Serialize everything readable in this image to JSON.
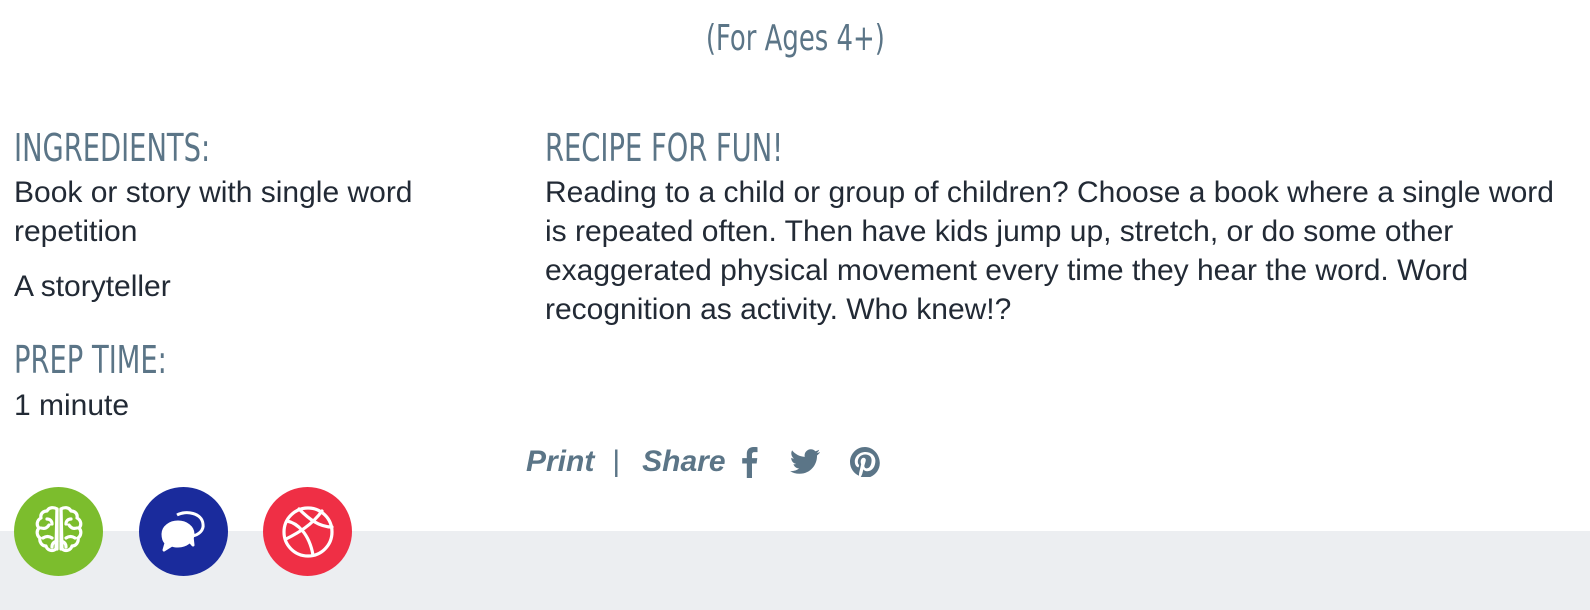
{
  "header": {
    "age_title": "(For Ages 4+)"
  },
  "ingredients": {
    "heading": "Ingredients:",
    "items": [
      "Book or story with single word repetition",
      "A storyteller"
    ]
  },
  "prep": {
    "heading": "Prep Time:",
    "value": "1 minute"
  },
  "recipe": {
    "heading": "Recipe for Fun!",
    "body": "Reading to a child or group of children? Choose a book where a single word is repeated often. Then have kids jump up, stretch, or do some other exaggerated physical movement every time they hear the word. Word recognition as activity. Who knew!?"
  },
  "actions": {
    "print_label": "Print",
    "separator": "|",
    "share_label": "Share",
    "social_icons": [
      "facebook-icon",
      "twitter-icon",
      "pinterest-icon"
    ]
  },
  "badges": [
    {
      "icon": "brain-icon",
      "color": "#7cbd2d"
    },
    {
      "icon": "chat-bubbles-icon",
      "color": "#1a2b9c"
    },
    {
      "icon": "basketball-icon",
      "color": "#ef2f45"
    }
  ],
  "colors": {
    "heading": "#5b7587",
    "body_text": "#222a35",
    "footer_band": "#eceef1"
  }
}
